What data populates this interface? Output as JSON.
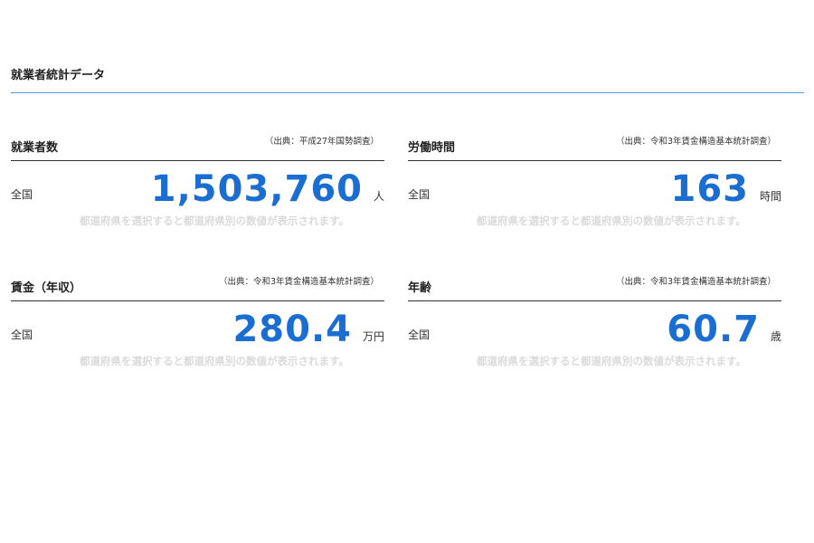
{
  "section": {
    "title": "就業者統計データ"
  },
  "cards": [
    {
      "title": "就業者数",
      "source": "（出典：平成27年国勢調査）",
      "scope": "全国",
      "value": "1,503,760",
      "unit": "人",
      "note": "都道府県を選択すると都道府県別の数値が表示されます。"
    },
    {
      "title": "労働時間",
      "source": "（出典：令和3年賃金構造基本統計調査）",
      "scope": "全国",
      "value": "163",
      "unit": "時間",
      "note": "都道府県を選択すると都道府県別の数値が表示されます。"
    },
    {
      "title": "賃金（年収）",
      "source": "（出典：令和3年賃金構造基本統計調査）",
      "scope": "全国",
      "value": "280.4",
      "unit": "万円",
      "note": "都道府県を選択すると都道府県別の数値が表示されます。"
    },
    {
      "title": "年齢",
      "source": "（出典：令和3年賃金構造基本統計調査）",
      "scope": "全国",
      "value": "60.7",
      "unit": "歳",
      "note": "都道府県を選択すると都道府県別の数値が表示されます。"
    }
  ],
  "colors": {
    "accent_value": "#1a6ed1",
    "section_rule": "#5b9bd5",
    "note_text": "#dadada"
  }
}
